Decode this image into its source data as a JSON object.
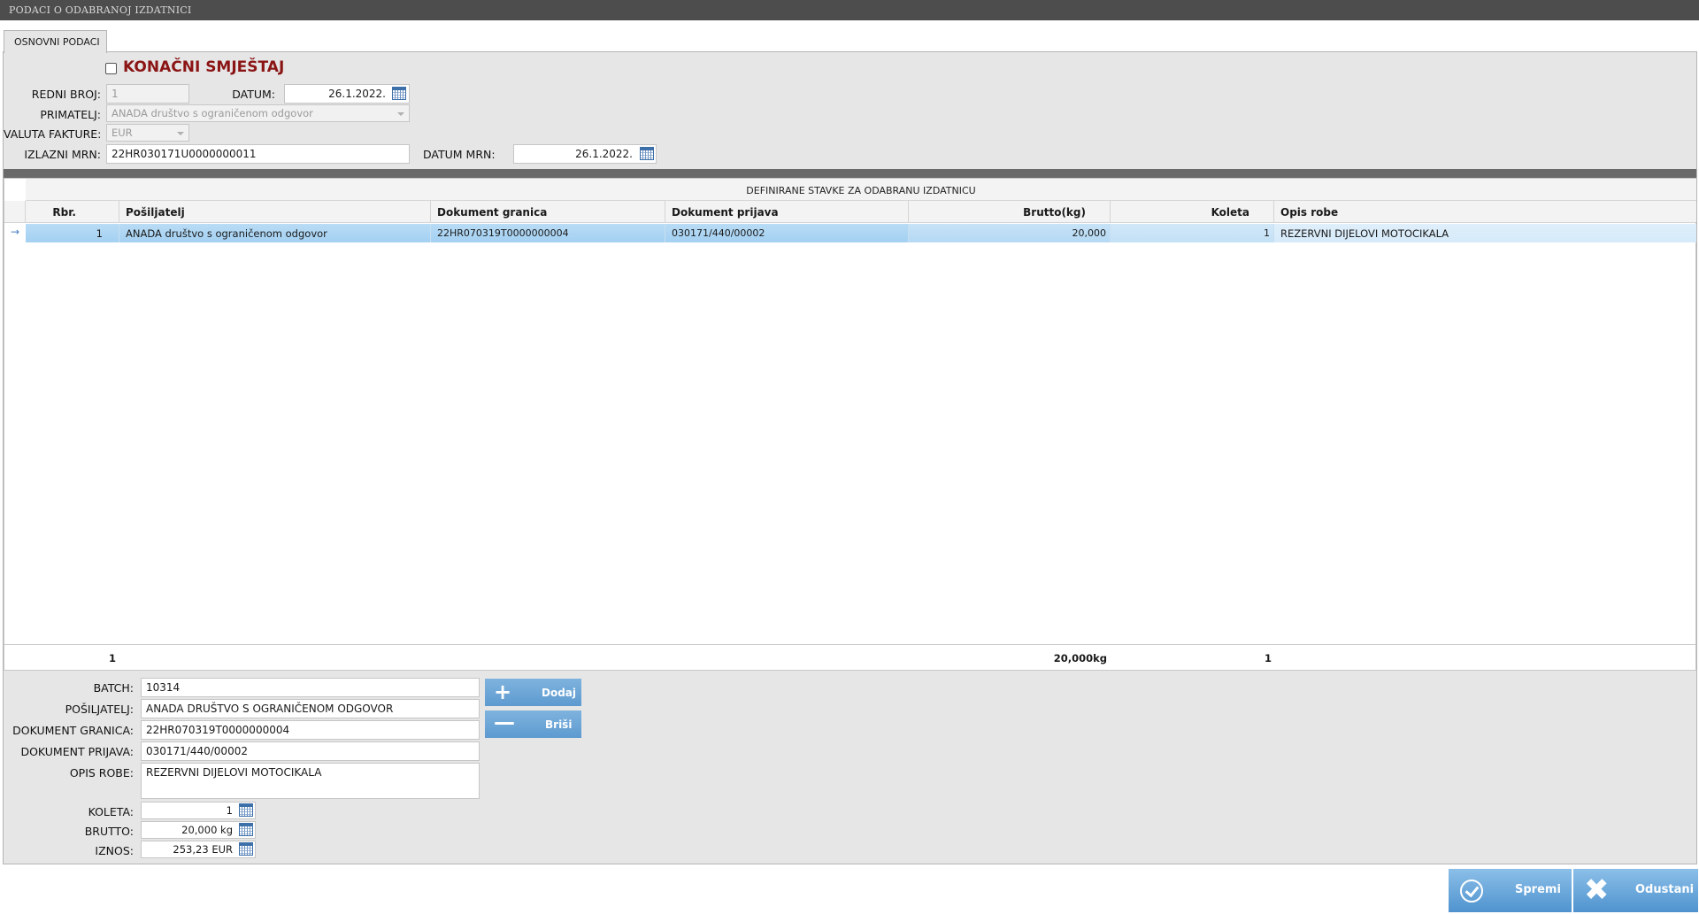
{
  "window": {
    "title": "PODACI O ODABRANOJ IZDATNICI"
  },
  "tab": {
    "label": "OSNOVNI PODACI"
  },
  "header": {
    "konacni_label": "KONAČNI SMJEŠTAJ",
    "konacni_checked": false,
    "redni_broj_label": "REDNI BROJ:",
    "redni_broj_value": "1",
    "datum_label": "DATUM:",
    "datum_value": "26.1.2022.",
    "primatelj_label": "PRIMATELJ:",
    "primatelj_value": "ANADA društvo s ograničenom odgovor",
    "valuta_label": "VALUTA FAKTURE:",
    "valuta_value": "EUR",
    "izlazni_mrn_label": "IZLAZNI MRN:",
    "izlazni_mrn_value": "22HR030171U0000000011",
    "datum_mrn_label": "DATUM MRN:",
    "datum_mrn_value": "26.1.2022."
  },
  "grid": {
    "title": "DEFINIRANE STAVKE ZA ODABRANU IZDATNICU",
    "columns": [
      "Rbr.",
      "Pošiljatelj",
      "Dokument granica",
      "Dokument prijava",
      "Brutto(kg)",
      "Koleta",
      "Opis robe"
    ],
    "rows": [
      {
        "rbr": "1",
        "posiljatelj": "ANADA društvo s ograničenom odgovor",
        "dokument_granica": "22HR070319T0000000004",
        "dokument_prijava": "030171/440/00002",
        "brutto": "20,000",
        "koleta": "1",
        "opis_robe": "REZERVNI DIJELOVI MOTOCIKALA"
      }
    ],
    "footer": {
      "count": "1",
      "brutto_total": "20,000kg",
      "koleta_total": "1"
    },
    "row_indicator": "→"
  },
  "detail": {
    "batch_label": "BATCH:",
    "batch_value": "10314",
    "posiljatelj_label": "POŠILJATELJ:",
    "posiljatelj_value": "ANADA DRUŠTVO S OGRANIČENOM ODGOVOR",
    "dok_granica_label": "DOKUMENT GRANICA:",
    "dok_granica_value": "22HR070319T0000000004",
    "dok_prijava_label": "DOKUMENT PRIJAVA:",
    "dok_prijava_value": "030171/440/00002",
    "opis_label": "OPIS ROBE:",
    "opis_value": "REZERVNI DIJELOVI MOTOCIKALA",
    "koleta_label": "KOLETA:",
    "koleta_value": "1",
    "brutto_label": "BRUTTO:",
    "brutto_value": "20,000 kg",
    "iznos_label": "IZNOS:",
    "iznos_value": "253,23 EUR"
  },
  "actions": {
    "dodaj": "Dodaj",
    "brisi": "Briši",
    "spremi": "Spremi",
    "odustani": "Odustani"
  },
  "colors": {
    "accent": "#5d9ad0",
    "title_red": "#8b1515",
    "selected_row": "#a4d0f2"
  }
}
